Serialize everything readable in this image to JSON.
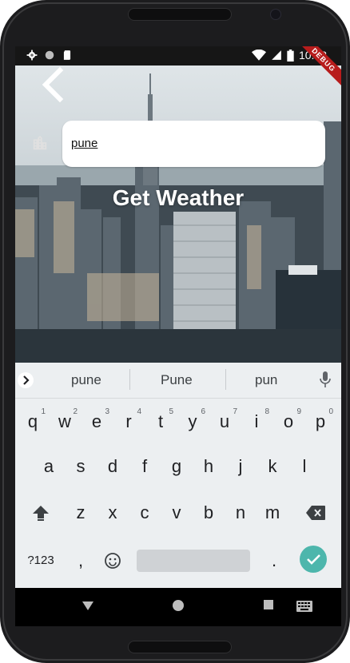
{
  "status_bar": {
    "time": "10:48",
    "icons": [
      "gear-icon",
      "circle-icon",
      "sd-card-icon",
      "wifi-icon",
      "signal-icon",
      "battery-icon"
    ]
  },
  "debug_banner": "DEBUG",
  "app": {
    "back_icon": "chevron-left-icon",
    "city_icon": "location-city-icon",
    "search": {
      "value": "pune"
    },
    "get_weather_label": "Get Weather"
  },
  "keyboard": {
    "suggestions": [
      "pune",
      "Pune",
      "pun"
    ],
    "row1": [
      {
        "k": "q",
        "n": "1"
      },
      {
        "k": "w",
        "n": "2"
      },
      {
        "k": "e",
        "n": "3"
      },
      {
        "k": "r",
        "n": "4"
      },
      {
        "k": "t",
        "n": "5"
      },
      {
        "k": "y",
        "n": "6"
      },
      {
        "k": "u",
        "n": "7"
      },
      {
        "k": "i",
        "n": "8"
      },
      {
        "k": "o",
        "n": "9"
      },
      {
        "k": "p",
        "n": "0"
      }
    ],
    "row2": [
      "a",
      "s",
      "d",
      "f",
      "g",
      "h",
      "j",
      "k",
      "l"
    ],
    "row3": [
      "z",
      "x",
      "c",
      "v",
      "b",
      "n",
      "m"
    ],
    "symbols_label": "?123",
    "comma_label": ",",
    "period_label": "."
  },
  "colors": {
    "accent_enter": "#4db6ac",
    "debug": "#b71c1c"
  }
}
